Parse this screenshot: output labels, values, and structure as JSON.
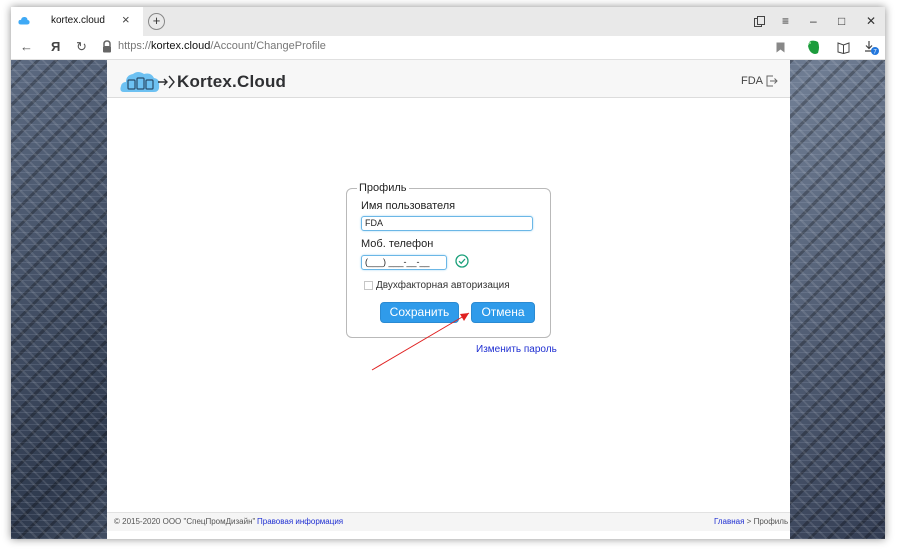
{
  "browser": {
    "tab_title": "kortex.cloud",
    "tab_close": "×",
    "new_tab": "+",
    "url_scheme": "https://",
    "url_host": "kortex.cloud",
    "url_path": "/Account/ChangeProfile",
    "nav_back": "←",
    "nav_home": "Я",
    "nav_reload": "↻",
    "win_menu": "≡",
    "win_min": "–",
    "win_max": "□",
    "win_close": "✕",
    "bookmark_icon": "bookmark-icon",
    "download_badge": "7"
  },
  "site": {
    "brand": "Kortex.Cloud",
    "user": "FDA"
  },
  "profile": {
    "legend": "Профиль",
    "username_label": "Имя пользователя",
    "username_value": "FDA",
    "phone_label": "Моб. телефон",
    "phone_value": "(___) ___-__-__",
    "twofa_label": "Двухфакторная авторизация",
    "twofa_checked": false,
    "save_label": "Сохранить",
    "cancel_label": "Отмена",
    "change_password": "Изменить пароль"
  },
  "footer": {
    "copyright": "© 2015-2020 ООО \"СпецПромДизайн\"",
    "legal": "Правовая информация",
    "crumb_home": "Главная",
    "crumb_sep": " > ",
    "crumb_current": "Профиль"
  },
  "colors": {
    "accent": "#2f9bea",
    "link": "#1f2fd2",
    "annotation": "#e02020",
    "success": "#1aa07a"
  }
}
